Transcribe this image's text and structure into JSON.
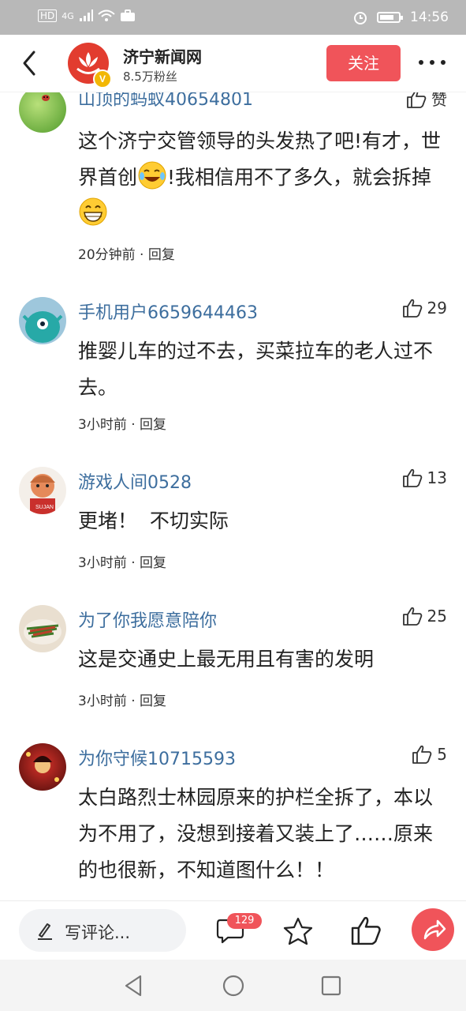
{
  "status_bar": {
    "signal": "4G",
    "time": "14:56",
    "battery_level": 0.75
  },
  "header": {
    "site_name": "济宁新闻网",
    "fans": "8.5万粉丝",
    "follow_label": "关注",
    "verified_badge": "V"
  },
  "comments": [
    {
      "user": "山顶的蚂蚁40654801",
      "likes": "赞",
      "content_parts": [
        "这个济宁交管领导的头发热了吧!有才，世界首创",
        "!我相信用不了多久，就会拆掉"
      ],
      "time": "20分钟前",
      "reply": "回复"
    },
    {
      "user": "手机用户6659644463",
      "likes": "29",
      "content": "推婴儿车的过不去，买菜拉车的老人过不去。",
      "time": "3小时前",
      "reply": "回复"
    },
    {
      "user": "游戏人间0528",
      "likes": "13",
      "content": "更堵！  不切实际",
      "time": "3小时前",
      "reply": "回复"
    },
    {
      "user": "为了你我愿意陪你",
      "likes": "25",
      "content": "这是交通史上最无用且有害的发明",
      "time": "3小时前",
      "reply": "回复"
    },
    {
      "user": "为你守候10715593",
      "likes": "5",
      "content": "太白路烈士林园原来的护栏全拆了，本以为不用了，没想到接着又装上了……原来的也很新，不知道图什么！！",
      "time": "",
      "reply": ""
    }
  ],
  "meta_separator": " · ",
  "bottom_bar": {
    "write_placeholder": "写评论...",
    "comment_count": "129"
  },
  "colors": {
    "accent": "#f0545a",
    "username": "#3d6e9e",
    "logo_red": "#e23c2f",
    "verified": "#f2b705"
  },
  "icons": [
    "back-arrow-icon",
    "more-icon",
    "thumbs-up-icon",
    "pencil-icon",
    "comment-icon",
    "star-icon",
    "share-icon",
    "nav-back-icon",
    "nav-home-icon",
    "nav-recent-icon"
  ]
}
